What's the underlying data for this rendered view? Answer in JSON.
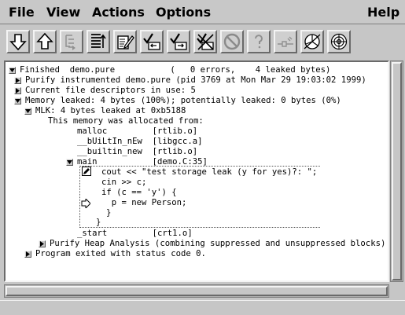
{
  "menubar": {
    "file": "File",
    "view": "View",
    "actions": "Actions",
    "options": "Options",
    "help": "Help"
  },
  "toolbar": {
    "icons": [
      "arrow-down-icon",
      "arrow-up-icon",
      "expand-tree-icon",
      "collapse-list-icon",
      "edit-source-icon",
      "suppress-check-icon",
      "unsuppress-check-icon",
      "kill-check-icon",
      "no-entry-icon",
      "help-question-icon",
      "connect-icon",
      "pie-chart-icon",
      "target-icon"
    ]
  },
  "output": {
    "lines": [
      {
        "text": "Finished  demo.pure           (   0 errors,    4 leaked bytes)"
      },
      {
        "text": "Purify instrumented demo.pure (pid 3769 at Mon Mar 29 19:03:02 1999)"
      },
      {
        "text": "Current file descriptors in use: 5"
      },
      {
        "text": "Memory leaked: 4 bytes (100%); potentially leaked: 0 bytes (0%)"
      },
      {
        "text": "MLK: 4 bytes leaked at 0xb5188"
      },
      {
        "text": "This memory was allocated from:"
      },
      {
        "text": "malloc         [rtlib.o]"
      },
      {
        "text": "__bUiLtIn_nEw  [libgcc.a]"
      },
      {
        "text": "__builtin_new  [rtlib.o]"
      },
      {
        "text": "main           [demo.C:35]"
      },
      {
        "text": "cout << \"test storage leak (y for yes)?: \";"
      },
      {
        "text": "cin >> c;"
      },
      {
        "text": "if (c == 'y') {"
      },
      {
        "text": "  p = new Person;"
      },
      {
        "text": "}"
      },
      {
        "text": "}"
      },
      {
        "text": "_start         [crt1.o]"
      },
      {
        "text": "Purify Heap Analysis (combining suppressed and unsuppressed blocks)"
      },
      {
        "text": "Program exited with status code 0."
      }
    ]
  }
}
